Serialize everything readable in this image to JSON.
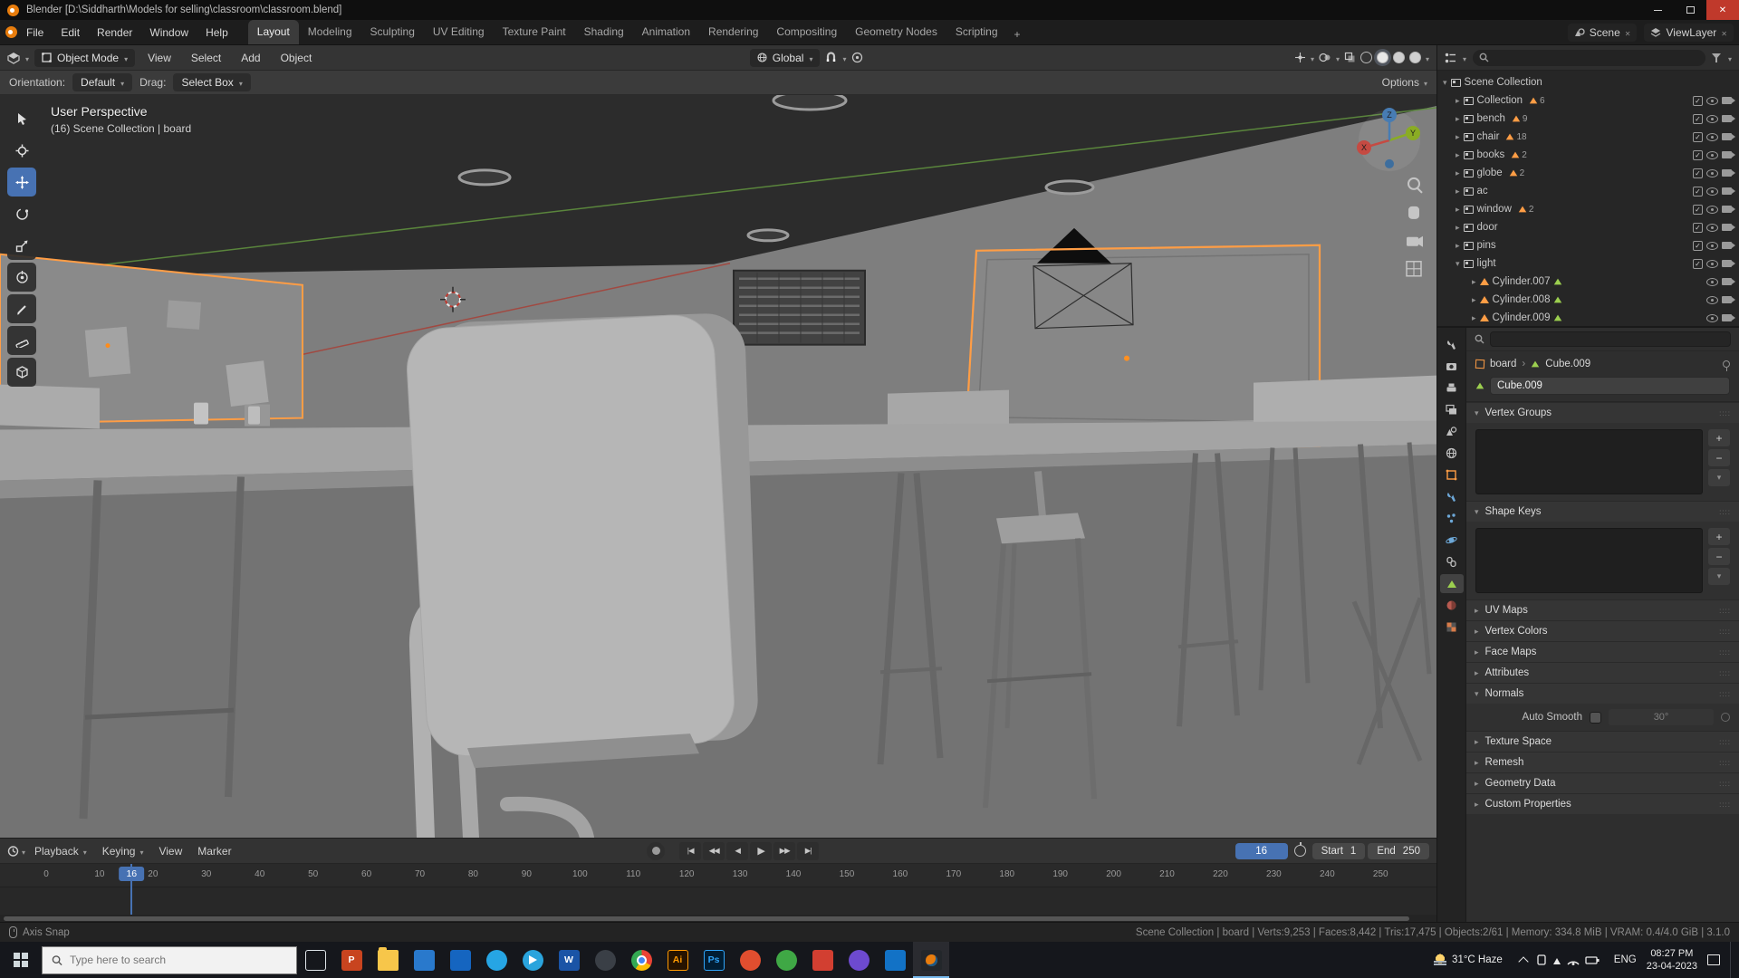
{
  "titlebar": {
    "title": "Blender [D:\\Siddharth\\Models for selling\\classroom\\classroom.blend]"
  },
  "menubar": {
    "menus": [
      "File",
      "Edit",
      "Render",
      "Window",
      "Help"
    ],
    "workspaces": [
      "Layout",
      "Modeling",
      "Sculpting",
      "UV Editing",
      "Texture Paint",
      "Shading",
      "Animation",
      "Rendering",
      "Compositing",
      "Geometry Nodes",
      "Scripting"
    ],
    "add_workspace": "+",
    "scene_label": "Scene",
    "viewlayer_label": "ViewLayer"
  },
  "tool_header": {
    "mode": "Object Mode",
    "menus": [
      "View",
      "Select",
      "Add",
      "Object"
    ],
    "orientation": "Global"
  },
  "tool_settings": {
    "orientation_label": "Orientation:",
    "orientation_value": "Default",
    "drag_label": "Drag:",
    "drag_value": "Select Box",
    "options_label": "Options"
  },
  "viewport": {
    "view_label": "User Perspective",
    "context_label": "(16) Scene Collection | board",
    "gizmo_x": "X",
    "gizmo_y": "Y",
    "gizmo_z": "Z",
    "selection_color": "#ff9d45"
  },
  "outliner": {
    "rows": [
      {
        "label": "Scene Collection"
      },
      {
        "label": "Collection",
        "count": "6"
      },
      {
        "label": "bench",
        "count": "9"
      },
      {
        "label": "chair",
        "count": "18"
      },
      {
        "label": "books",
        "count": "2"
      },
      {
        "label": "globe",
        "count": "2"
      },
      {
        "label": "ac",
        "count": ""
      },
      {
        "label": "window",
        "count": "2"
      },
      {
        "label": "door",
        "count": ""
      },
      {
        "label": "pins",
        "count": ""
      },
      {
        "label": "light",
        "count": ""
      },
      {
        "label": "Cylinder.007"
      },
      {
        "label": "Cylinder.008"
      },
      {
        "label": "Cylinder.009"
      }
    ]
  },
  "properties": {
    "breadcrumb_object": "board",
    "breadcrumb_data": "Cube.009",
    "name_value": "Cube.009",
    "panels": {
      "vertex_groups": "Vertex Groups",
      "shape_keys": "Shape Keys",
      "uv_maps": "UV Maps",
      "vertex_colors": "Vertex Colors",
      "face_maps": "Face Maps",
      "attributes": "Attributes",
      "normals": "Normals",
      "texture_space": "Texture Space",
      "remesh": "Remesh",
      "geometry_data": "Geometry Data",
      "custom_properties": "Custom Properties"
    },
    "normals_panel": {
      "auto_smooth_label": "Auto Smooth",
      "auto_smooth_value": "30°"
    }
  },
  "timeline": {
    "menus": [
      "Playback",
      "Keying",
      "View",
      "Marker"
    ],
    "transport": [
      "|◀",
      "◀◀",
      "◀",
      "▶",
      "▶▶",
      "▶|"
    ],
    "current_frame": "16",
    "start_label": "Start",
    "start_value": "1",
    "end_label": "End",
    "end_value": "250",
    "frame_start": 0,
    "frame_end": 250,
    "tick_step": 10
  },
  "statusbar": {
    "left_hint": "Axis Snap",
    "stats": "Scene Collection | board | Verts:9,253 | Faces:8,442 | Tris:17,475 | Objects:2/61 | Memory: 334.8 MiB | VRAM: 0.4/4.0 GiB | 3.1.0"
  },
  "taskbar": {
    "search_placeholder": "Type here to search",
    "weather": "31°C Haze",
    "language": "ENG",
    "time": "08:27 PM",
    "date": "23-04-2023",
    "app_glyphs": {
      "powerpoint": "P",
      "word": "W",
      "illustrator": "Ai",
      "photoshop": "Ps"
    }
  }
}
